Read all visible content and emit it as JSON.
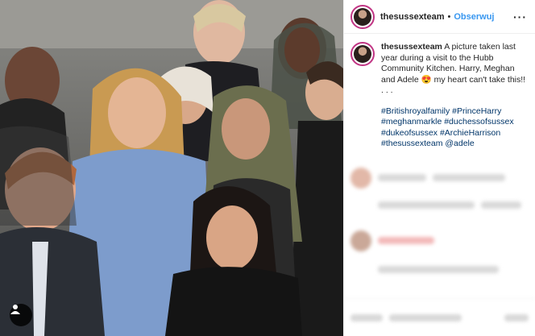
{
  "header": {
    "username": "thesussexteam",
    "separator": "•",
    "follow_label": "Obserwuj",
    "more_icon": "more-options-icon"
  },
  "caption": {
    "username": "thesussexteam",
    "text": "A picture taken last year during a visit to the Hubb Community Kitchen. Harry, Meghan and Adele 😍 my heart can't take this!!",
    "ellipsis": ". . .",
    "hashtags": "#Britishroyalfamily #PrinceHarry #meghanmarkle #duchessofsussex #dukeofsussex #ArchieHarrison #thesussexteam @adele"
  },
  "photo": {
    "tag_icon": "user-tag-icon"
  },
  "colors": {
    "link": "#3897f0",
    "hashtag": "#003569",
    "ring": "#c13584"
  }
}
